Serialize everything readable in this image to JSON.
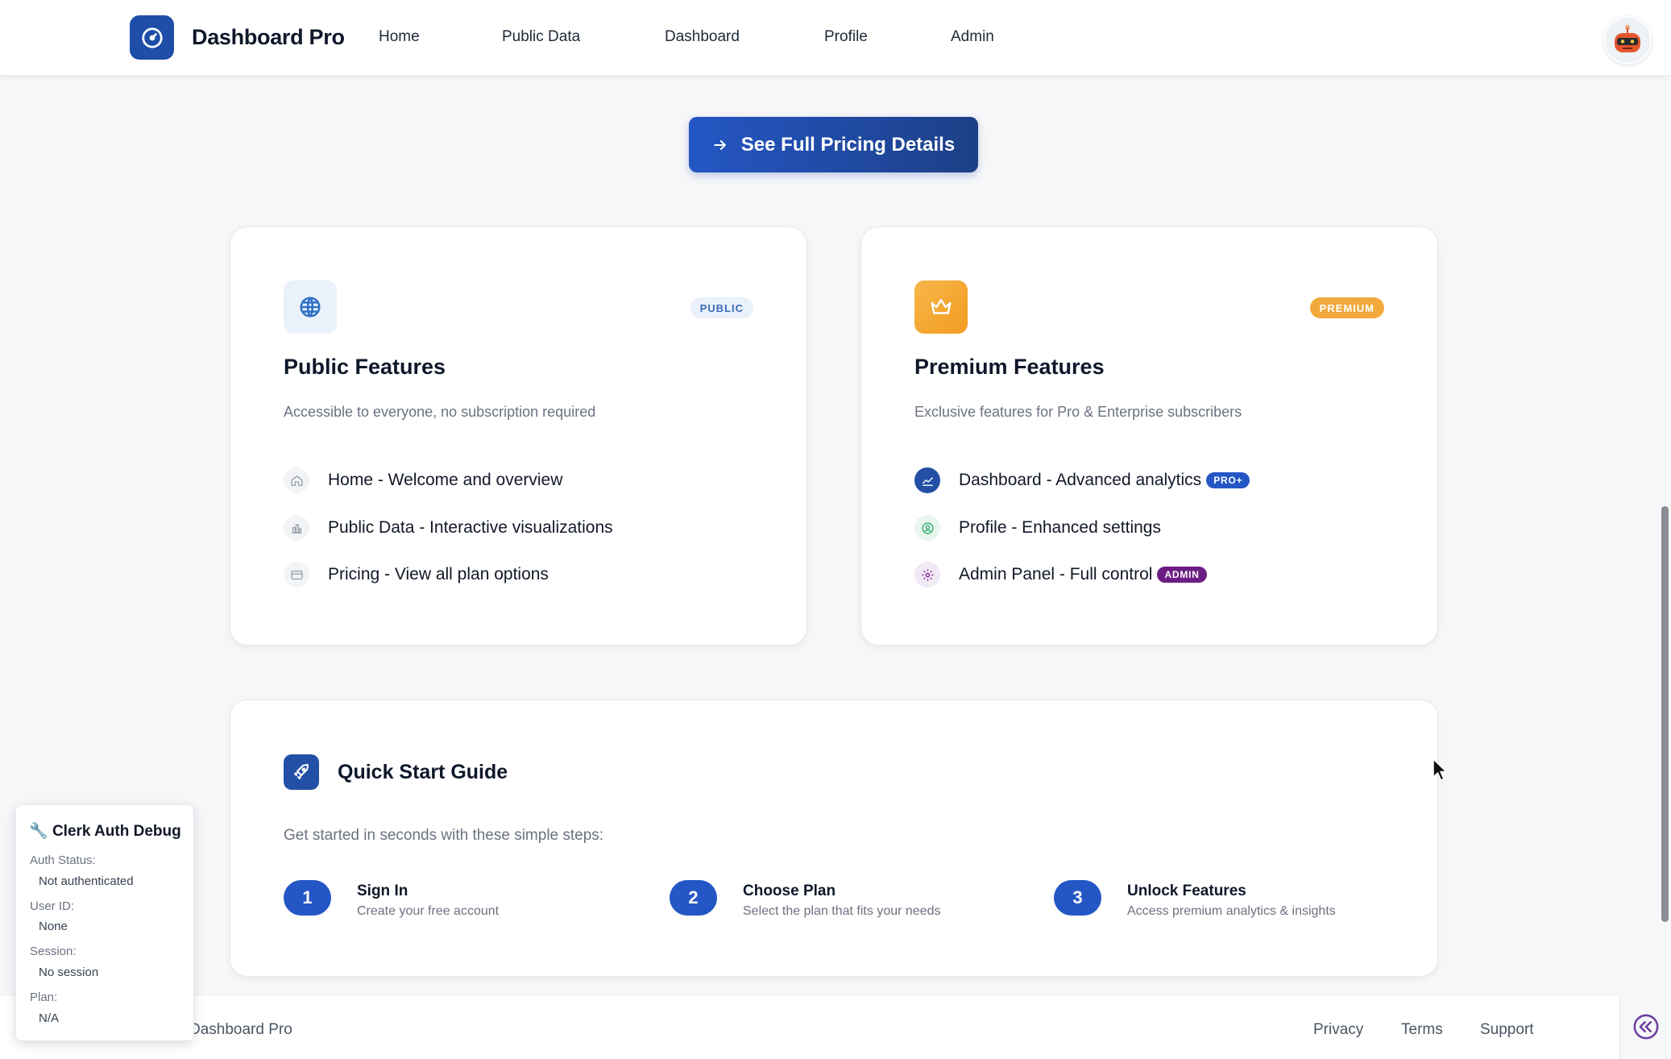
{
  "app": {
    "brand": "Dashboard Pro"
  },
  "nav": {
    "items": [
      "Home",
      "Public Data",
      "Dashboard",
      "Profile",
      "Admin"
    ]
  },
  "cta": {
    "label": "See Full Pricing Details"
  },
  "public_card": {
    "badge": "PUBLIC",
    "title": "Public Features",
    "subtitle": "Accessible to everyone, no subscription required",
    "features": [
      {
        "label": "Home - Welcome and overview",
        "icon": "home-icon"
      },
      {
        "label": "Public Data - Interactive visualizations",
        "icon": "bar-chart-icon"
      },
      {
        "label": "Pricing - View all plan options",
        "icon": "credit-card-icon"
      }
    ]
  },
  "premium_card": {
    "badge": "PREMIUM",
    "title": "Premium Features",
    "subtitle": "Exclusive features for Pro & Enterprise subscribers",
    "features": [
      {
        "label": "Dashboard - Advanced analytics",
        "tag": "PRO+",
        "icon": "analytics-icon"
      },
      {
        "label": "Profile - Enhanced settings",
        "icon": "user-circle-icon"
      },
      {
        "label": "Admin Panel - Full control",
        "tag": "ADMIN",
        "icon": "settings-gear-icon"
      }
    ]
  },
  "quick_start": {
    "title": "Quick Start Guide",
    "subtitle": "Get started in seconds with these simple steps:",
    "steps": [
      {
        "num": "1",
        "title": "Sign In",
        "desc": "Create your free account"
      },
      {
        "num": "2",
        "title": "Choose Plan",
        "desc": "Select the plan that fits your needs"
      },
      {
        "num": "3",
        "title": "Unlock Features",
        "desc": "Access premium analytics & insights"
      }
    ]
  },
  "footer": {
    "brand": "Dashboard Pro",
    "links": [
      "Privacy",
      "Terms",
      "Support"
    ]
  },
  "debug": {
    "title": "Clerk Auth Debug",
    "icon": "🔧",
    "fields": [
      {
        "label": "Auth Status:",
        "value": "Not authenticated"
      },
      {
        "label": "User ID:",
        "value": "None"
      },
      {
        "label": "Session:",
        "value": "No session"
      },
      {
        "label": "Plan:",
        "value": "N/A"
      }
    ]
  },
  "colors": {
    "primary": "#2457c5",
    "navy": "#1e4ea8",
    "premium": "#f2a93b",
    "admin_tag": "#6b1d83",
    "background": "#f6f7f9"
  }
}
